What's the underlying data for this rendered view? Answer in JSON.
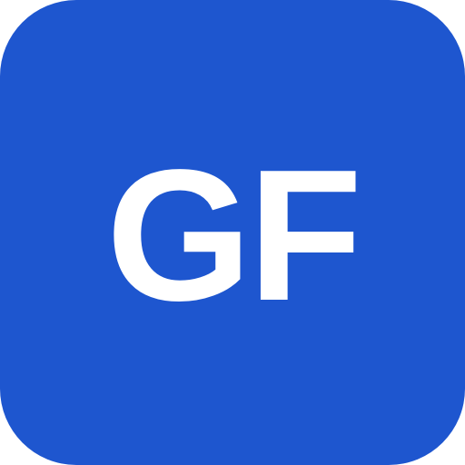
{
  "app_icon": {
    "monogram": "GF",
    "background_color": "#1e56cf",
    "text_color": "#ffffff"
  }
}
